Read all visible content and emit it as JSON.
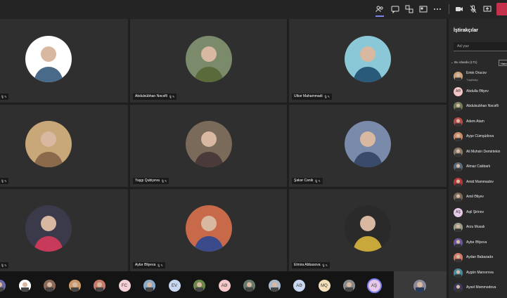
{
  "panel": {
    "title": "İştirakçılar",
    "search_placeholder": "Ad yaz",
    "section_label": "Bu iclasda (171)",
    "mute_all": "Hamını",
    "participants": [
      {
        "name": "Emin Orucov",
        "sub": "Təşkilatçı",
        "color": "#c9a07a"
      },
      {
        "name": "Abdulla Əliyev",
        "initials": "AƏ",
        "color": "#f4c6c6"
      },
      {
        "name": "Abdulsubhan Nəcəfli",
        "color": "#6f7f5a"
      },
      {
        "name": "Adem Atam",
        "color": "#b24a4a"
      },
      {
        "name": "Ayşe Cümşüdova",
        "color": "#c98a6a"
      },
      {
        "name": "Ali Muhsin Demirtekin",
        "color": "#8a7a6a"
      },
      {
        "name": "Almaz Cabbarlı",
        "color": "#5a6a7a"
      },
      {
        "name": "Amid Mammadov",
        "color": "#b23a3a"
      },
      {
        "name": "Amil Əliyev",
        "color": "#7a6a5a"
      },
      {
        "name": "Aqil Şirinov",
        "initials": "AŞ",
        "color": "#e8c8e8"
      },
      {
        "name": "Arzu Musalı",
        "color": "#9a9a8a"
      },
      {
        "name": "Aybə Əliyeva",
        "color": "#6a5a9a"
      },
      {
        "name": "Aydan Babazadə",
        "color": "#d07a6a"
      },
      {
        "name": "Aygün Mansırova",
        "color": "#4a8a9a"
      },
      {
        "name": "Aysel Məmmədova",
        "color": "#3a3a5a"
      }
    ]
  },
  "tiles": [
    {
      "name": "",
      "color": "#4a6a8a",
      "bg": "#ffffff"
    },
    {
      "name": "Abdulsübhan Nəcəfli",
      "color": "#5a6a3a",
      "bg": "#7a8a6a"
    },
    {
      "name": "Ulkər Mahammadi",
      "color": "#2a5a7a",
      "bg": "#8ac8d8"
    },
    {
      "name": "",
      "color": "#8a6a4a",
      "bg": "#c8a878"
    },
    {
      "name": "Yaşgı Qubiyeva",
      "color": "#4a3a3a",
      "bg": "#7a6a5a"
    },
    {
      "name": "Şəkər Cənik",
      "color": "#3a4a6a",
      "bg": "#7a8aaa"
    },
    {
      "name": "",
      "color": "#c83a5a",
      "bg": "#3a3a4a"
    },
    {
      "name": "Aybə Əliyeva",
      "color": "#3a4a8a",
      "bg": "#c86a4a"
    },
    {
      "name": "Elmira Abbasova",
      "color": "#c8a83a",
      "bg": "#2a2a2a"
    }
  ],
  "strip": [
    {
      "initials": "",
      "color": "#6a6aaa"
    },
    {
      "initials": "",
      "color": "#ffffff"
    },
    {
      "initials": "",
      "color": "#8a6a5a"
    },
    {
      "initials": "",
      "color": "#c89a6a"
    },
    {
      "initials": "",
      "color": "#c87a6a"
    },
    {
      "initials": "FC",
      "color": "#f4d0d8"
    },
    {
      "initials": "",
      "color": "#8aaac8"
    },
    {
      "initials": "EV",
      "color": "#c8d8f0"
    },
    {
      "initials": "",
      "color": "#6a8a4a"
    },
    {
      "initials": "AƏ",
      "color": "#f4c8c8"
    },
    {
      "initials": "",
      "color": "#6a7a6a"
    },
    {
      "initials": "",
      "color": "#aab8c8"
    },
    {
      "initials": "AƏ",
      "color": "#c8d8f0"
    },
    {
      "initials": "MQ",
      "color": "#f4e0b8"
    },
    {
      "initials": "",
      "color": "#8a8a8a"
    },
    {
      "initials": "AŞ",
      "color": "#e8c8e8"
    }
  ],
  "toolbar": {
    "icons": [
      "participants-icon",
      "chat-icon",
      "breakout-icon",
      "layout-icon",
      "more-icon",
      "camera-icon",
      "mic-off-icon",
      "share-icon"
    ]
  }
}
